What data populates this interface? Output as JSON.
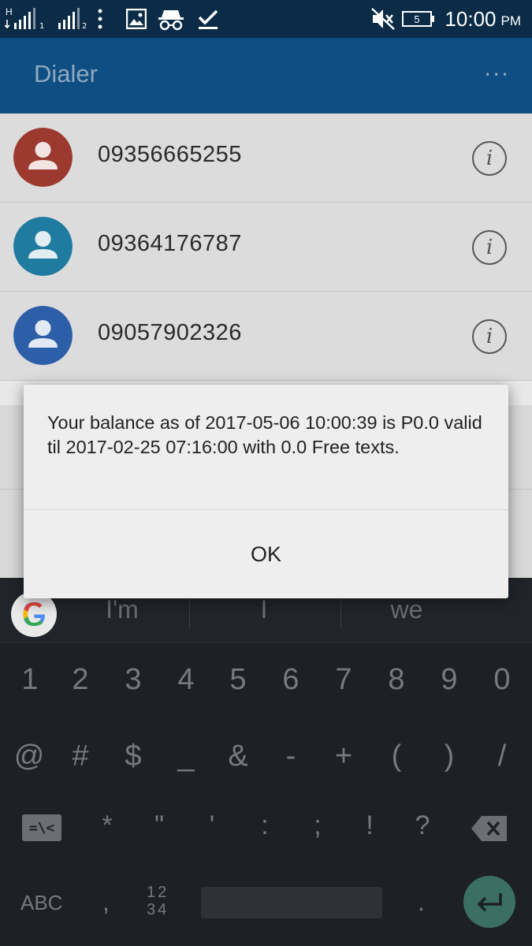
{
  "status_bar": {
    "time": "10:00",
    "ampm": "PM",
    "battery_level": "5",
    "network_label": "H",
    "sim1": "1",
    "sim2": "2",
    "icons": [
      "signal-sim1-icon",
      "signal-sim2-icon",
      "more-vert-icon",
      "image-icon",
      "incognito-icon",
      "check-icon",
      "mute-icon",
      "battery-icon"
    ]
  },
  "app_bar": {
    "title": "Dialer",
    "menu_label": "···"
  },
  "call_log": [
    {
      "number": "09356665255",
      "avatar_color": "#b43a2c"
    },
    {
      "number": "09364176787",
      "avatar_color": "#1e7fa6"
    },
    {
      "number": "09057902326",
      "avatar_color": "#2f62ad"
    }
  ],
  "info_label": "i",
  "dialog": {
    "message": "Your balance as of 2017-05-06 10:00:39 is P0.0 valid til 2017-02-25 07:16:00 with 0.0 Free texts.",
    "ok_label": "OK"
  },
  "keyboard": {
    "suggestions": [
      "I'm",
      "I",
      "we"
    ],
    "number_row": [
      "1",
      "2",
      "3",
      "4",
      "5",
      "6",
      "7",
      "8",
      "9",
      "0"
    ],
    "symbol_row": [
      "@",
      "#",
      "$",
      "_",
      "&",
      "-",
      "+",
      "(",
      ")",
      "/"
    ],
    "symbol_row2": [
      "*",
      "\"",
      "'",
      ":",
      ";",
      "!",
      "?"
    ],
    "more_symbols_label": "=\\<",
    "abc_label": "ABC",
    "comma": ",",
    "numpad_top": "12",
    "numpad_bottom": "34",
    "period": ".",
    "accent_color": "#3b6f63"
  }
}
